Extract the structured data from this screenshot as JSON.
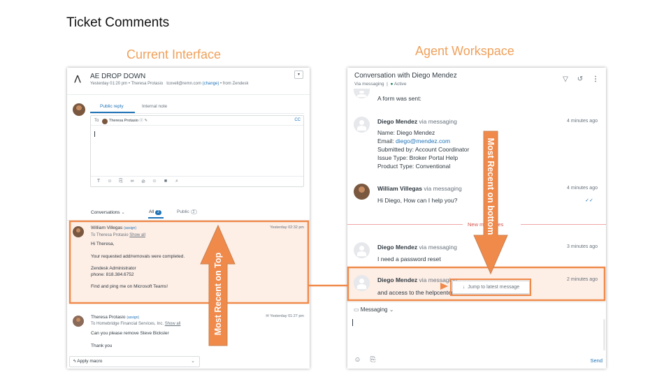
{
  "slide": {
    "title": "Ticket Comments",
    "left_label": "Current Interface",
    "right_label": "Agent Workspace",
    "arrow_top_text": "Most Recent on Top",
    "arrow_bottom_text": "Most Recent on bottom"
  },
  "colors": {
    "accent_orange": "#f08a4b",
    "highlight_bg": "#fdeee6",
    "link_blue": "#1f73b7",
    "active_green": "#038153"
  },
  "current": {
    "ticket_title": "AE DROP DOWN",
    "ticket_meta_time": "Yesterday 01:20 pm",
    "ticket_meta_requester": "Theresa Protasio",
    "ticket_meta_email": "tcovell@remn.com",
    "ticket_meta_change": "(change)",
    "ticket_meta_from": "from Zendesk",
    "tab_public": "Public reply",
    "tab_internal": "Internal note",
    "to_label": "To",
    "to_recipient": "Theresa Protasio",
    "cc_label": "CC",
    "filter_conversations": "Conversations",
    "filter_all": "All",
    "filter_all_count": "2",
    "filter_public": "Public",
    "filter_public_count": "2",
    "comments": [
      {
        "author": "William Villegas",
        "assign": "(assign)",
        "time": "Yesterday 02:32 pm",
        "to_prefix": "To Theresa Protasio",
        "show_all": "Show all",
        "lines": [
          "Hi Theresa,",
          "Your requested add/removals were completed.",
          "Zendesk Administrator",
          "phone: 818.384.6752",
          "Find and ping me on Microsoft Teams!"
        ]
      },
      {
        "author": "Theresa Protasio",
        "assign": "(assign)",
        "time": "Yesterday 01:27 pm",
        "to_prefix": "To Homebridge Financial Services, Inc.",
        "show_all": "Show all",
        "lines": [
          "Can you please remove Steve Bicksler",
          "Thank you"
        ]
      }
    ],
    "apply_macro": "Apply macro"
  },
  "workspace": {
    "title": "Conversation with Diego Mendez",
    "channel": "Via messaging",
    "status": "Active",
    "form_sent": "A form was sent:",
    "messages": [
      {
        "author": "Diego Mendez",
        "via": "via messaging",
        "time": "4 minutes ago",
        "lines": [
          "Name: Diego Mendez",
          "Email:",
          "Submitted by: Account Coordinator",
          "Issue Type: Broker Portal Help",
          "Product Type: Conventional"
        ],
        "email": "diego@mendez.com"
      },
      {
        "author": "William Villegas",
        "via": "via messaging",
        "time": "4 minutes ago",
        "lines": [
          "Hi Diego, How can I help you?"
        ]
      },
      {
        "author": "Diego Mendez",
        "via": "via messaging",
        "time": "3 minutes ago",
        "lines": [
          "I need a password reset"
        ]
      },
      {
        "author": "Diego Mendez",
        "via": "via messaging",
        "time": "2 minutes ago",
        "lines": [
          "and access to the helpcenter"
        ]
      }
    ],
    "new_messages": "New messages",
    "jump_latest": "Jump to latest message",
    "composer_channel": "Messaging",
    "send": "Send"
  }
}
